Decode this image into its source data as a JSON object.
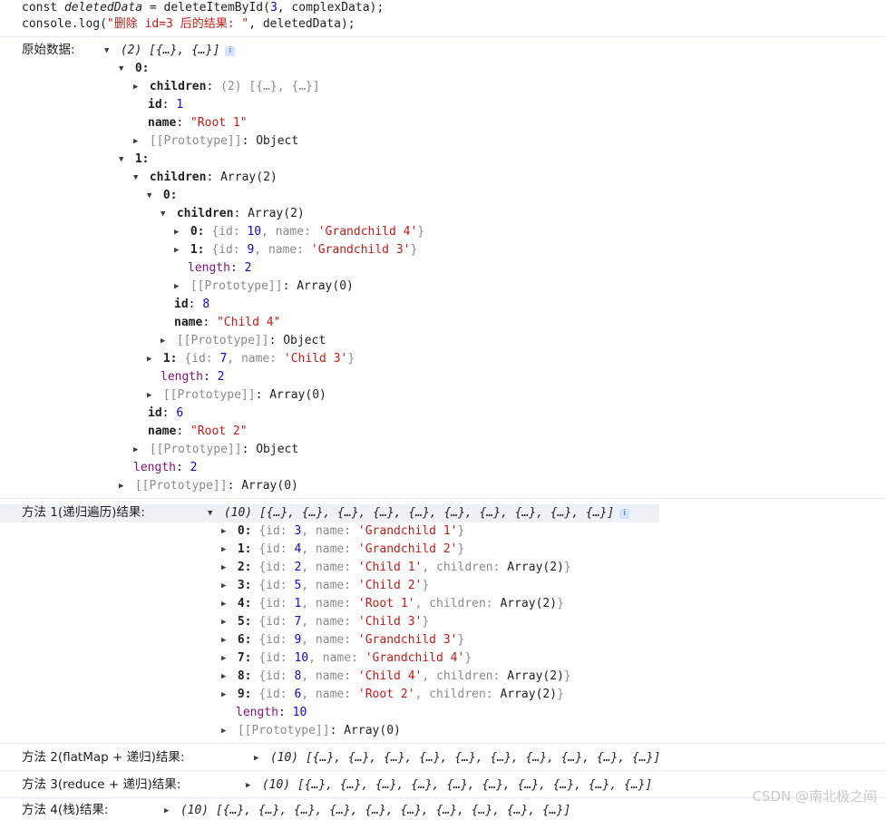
{
  "code": {
    "line1": {
      "a": "const ",
      "b": "deletedData",
      "c": " = deleteItemById(",
      "d": "3",
      "e": ", complexData);"
    },
    "line2": {
      "a": "console.log(",
      "b": "\"删除 id=3 后的结果: \"",
      "c": ", deletedData);"
    }
  },
  "original": {
    "label": "原始数据:",
    "summary": "(2) [{…}, {…}]",
    "info": "i",
    "item0": {
      "key": "0:",
      "children_key": "children",
      "children_val": "(2) [{…}, {…}]",
      "id_key": "id",
      "id_val": "1",
      "name_key": "name",
      "name_val": "\"Root 1\"",
      "proto_key": "[[Prototype]]",
      "proto_val": "Object"
    },
    "item1": {
      "key": "1:",
      "children_key": "children",
      "children_val": "Array(2)",
      "child0": {
        "key": "0:",
        "children_key": "children",
        "children_val": "Array(2)",
        "g0": {
          "key": "0:",
          "id_key": "id",
          "id": "10",
          "name_key": "name",
          "name": "'Grandchild 4'"
        },
        "g1": {
          "key": "1:",
          "id_key": "id",
          "id": "9",
          "name_key": "name",
          "name": "'Grandchild 3'"
        },
        "length_key": "length",
        "length_val": "2",
        "arr_proto_key": "[[Prototype]]",
        "arr_proto_val": "Array(0)",
        "id_key": "id",
        "id_val": "8",
        "name_key": "name",
        "name_val": "\"Child 4\"",
        "proto_key": "[[Prototype]]",
        "proto_val": "Object"
      },
      "child1": {
        "key": "1:",
        "id_key": "id",
        "id": "7",
        "name_key": "name",
        "name": "'Child 3'"
      },
      "length_key": "length",
      "length_val": "2",
      "arr_proto_key": "[[Prototype]]",
      "arr_proto_val": "Array(0)",
      "id_key": "id",
      "id_val": "6",
      "name_key": "name",
      "name_val": "\"Root 2\"",
      "proto_key": "[[Prototype]]",
      "proto_val": "Object"
    },
    "length_key": "length",
    "length_val": "2",
    "proto_key": "[[Prototype]]",
    "proto_val": "Array(0)"
  },
  "method1": {
    "label": "方法 1(递归遍历)结果:",
    "summary": "(10) [{…}, {…}, {…}, {…}, {…}, {…}, {…}, {…}, {…}, {…}]",
    "info": "i",
    "items": [
      {
        "key": "0:",
        "id": "3",
        "name": "'Grandchild 1'",
        "children": ""
      },
      {
        "key": "1:",
        "id": "4",
        "name": "'Grandchild 2'",
        "children": ""
      },
      {
        "key": "2:",
        "id": "2",
        "name": "'Child 1'",
        "children": "Array(2)"
      },
      {
        "key": "3:",
        "id": "5",
        "name": "'Child 2'",
        "children": ""
      },
      {
        "key": "4:",
        "id": "1",
        "name": "'Root 1'",
        "children": "Array(2)"
      },
      {
        "key": "5:",
        "id": "7",
        "name": "'Child 3'",
        "children": ""
      },
      {
        "key": "6:",
        "id": "9",
        "name": "'Grandchild 3'",
        "children": ""
      },
      {
        "key": "7:",
        "id": "10",
        "name": "'Grandchild 4'",
        "children": ""
      },
      {
        "key": "8:",
        "id": "8",
        "name": "'Child 4'",
        "children": "Array(2)"
      },
      {
        "key": "9:",
        "id": "6",
        "name": "'Root 2'",
        "children": "Array(2)"
      }
    ],
    "length_key": "length",
    "length_val": "10",
    "proto_key": "[[Prototype]]",
    "proto_val": "Array(0)"
  },
  "method2": {
    "label": "方法 2(flatMap + 递归)结果:",
    "summary": "(10) [{…}, {…}, {…}, {…}, {…}, {…}, {…}, {…}, {…}, {…}]"
  },
  "method3": {
    "label": "方法 3(reduce + 递归)结果:",
    "summary": "(10) [{…}, {…}, {…}, {…}, {…}, {…}, {…}, {…}, {…}, {…}]"
  },
  "method4": {
    "label": "方法 4(栈)结果:",
    "summary": "(10) [{…}, {…}, {…}, {…}, {…}, {…}, {…}, {…}, {…}, {…}]"
  },
  "watermark": "CSDN @南北极之间",
  "colors": {
    "key": "#881280",
    "number": "#1c00cf",
    "string": "#c41a16",
    "muted": "#8a8a8a",
    "separator": "#e6e9ee"
  }
}
